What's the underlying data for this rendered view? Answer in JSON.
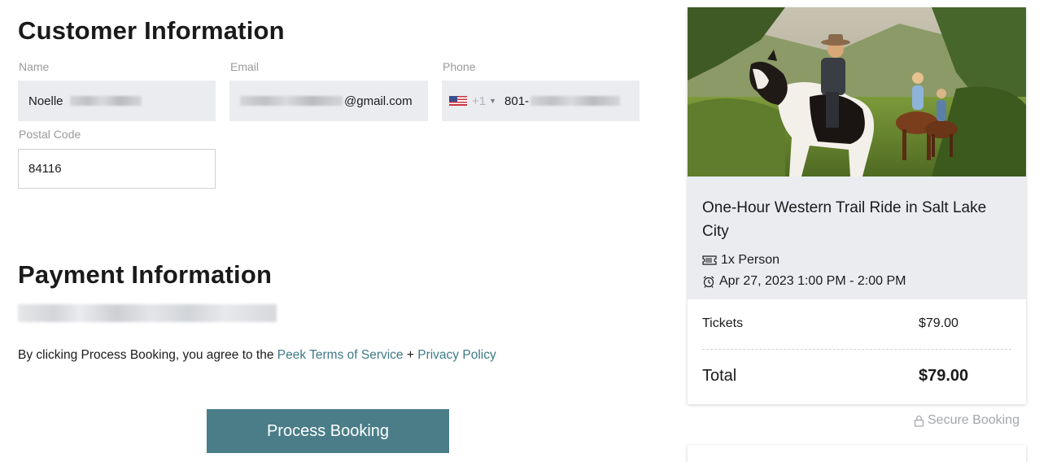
{
  "customer": {
    "heading": "Customer Information",
    "name_label": "Name",
    "name_value": "Noelle",
    "email_label": "Email",
    "email_value": "@gmail.com",
    "phone_label": "Phone",
    "phone_country_code": "+1",
    "phone_value": "801-",
    "postal_label": "Postal Code",
    "postal_value": "84116"
  },
  "payment": {
    "heading": "Payment Information",
    "agree_prefix": "By clicking Process Booking, you agree to the ",
    "terms_link": "Peek Terms of Service",
    "plus": " + ",
    "privacy_link": "Privacy Policy",
    "button_label": "Process Booking"
  },
  "summary": {
    "title": "One-Hour Western Trail Ride in Salt Lake City",
    "quantity": "1x Person",
    "datetime": "Apr 27, 2023 1:00 PM - 2:00 PM",
    "tickets_label": "Tickets",
    "tickets_value": "$79.00",
    "total_label": "Total",
    "total_value": "$79.00",
    "secure_label": "Secure Booking"
  },
  "icons": {
    "ticket": "ticket-icon",
    "alarm": "alarm-clock-icon",
    "lock": "lock-icon",
    "flag": "us-flag-icon",
    "caret": "chevron-down-icon"
  },
  "colors": {
    "accent": "#4a7d88",
    "link": "#3e7a86",
    "field_bg": "#ebecf0"
  }
}
